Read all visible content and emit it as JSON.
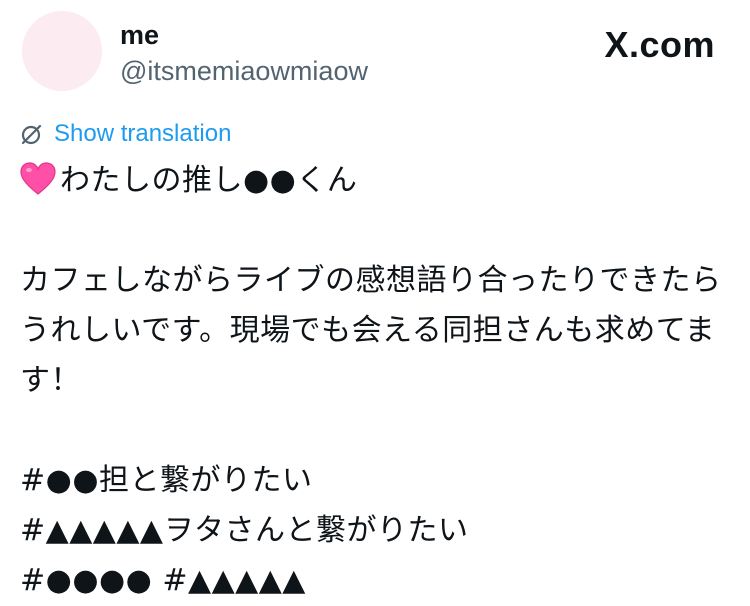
{
  "author": {
    "name": "me",
    "handle": "@itsmemiaowmiaow"
  },
  "brand": {
    "label": "X.com"
  },
  "translation": {
    "label": "Show translation",
    "icon": "no-translate-icon"
  },
  "post": {
    "emoji": "pink-heart-icon",
    "line1": "わたしの推し●●くん",
    "line3": "カフェしながらライブの感想語り合ったりできたら",
    "line4": "うれしいです。現場でも会える同担さんも求めてま",
    "line5": "す！",
    "hashtag1": "#●●担と繋がりたい",
    "hashtag2": "#▲▲▲▲▲ヲタさんと繋がりたい",
    "hashtag3": "#●●●● #▲▲▲▲▲"
  },
  "colors": {
    "link": "#1d9bf0",
    "secondary_text": "#536471",
    "primary_text": "#0f1419",
    "avatar_bg": "#fcebf1",
    "heart": "#ff4fa6"
  }
}
